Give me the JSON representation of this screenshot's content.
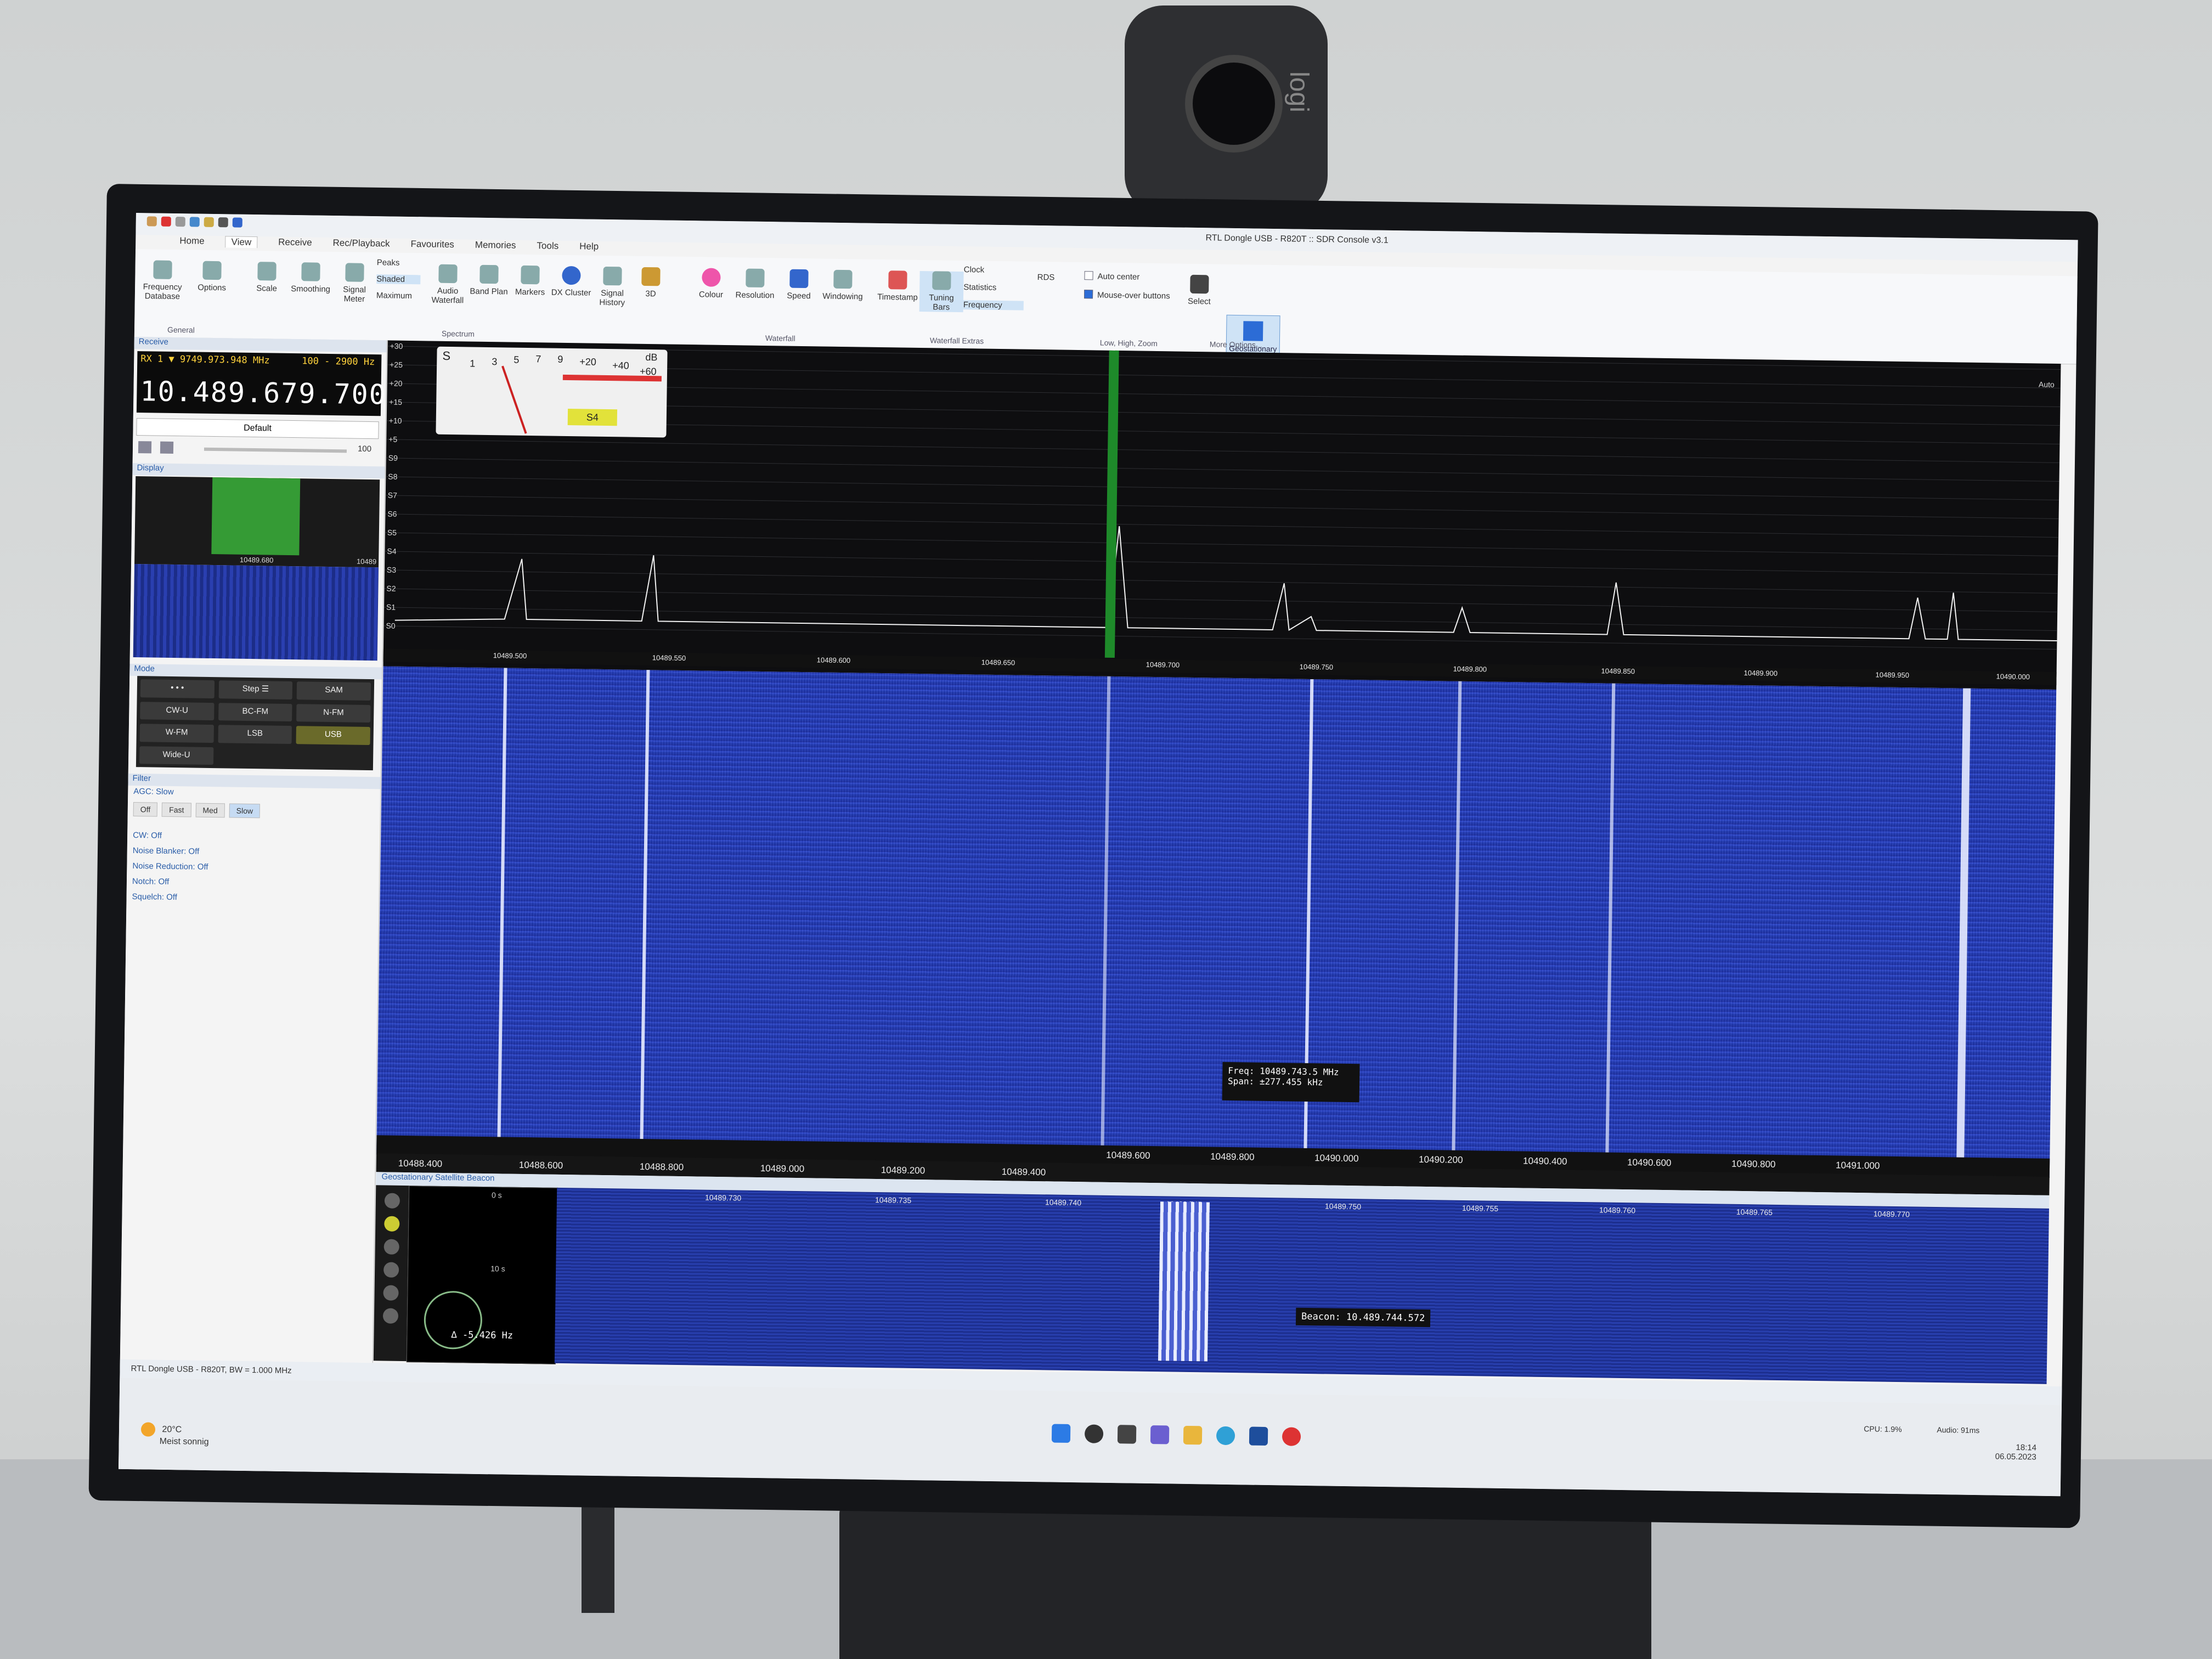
{
  "window": {
    "title": "RTL Dongle USB - R820T :: SDR Console v3.1"
  },
  "ribbon_tabs": [
    "Home",
    "View",
    "Receive",
    "Rec/Playback",
    "Favourites",
    "Memories",
    "Tools",
    "Help"
  ],
  "ribbon": {
    "general": {
      "label": "General",
      "buttons": [
        "Frequency Database",
        "Options"
      ]
    },
    "spectrum": {
      "label": "Spectrum",
      "buttons": [
        "Scale",
        "Smoothing",
        "Signal Meter",
        "Peaks",
        "Shaded",
        "Maximum",
        "Audio Waterfall",
        "Band Plan",
        "Markers",
        "DX Cluster",
        "Signal History",
        "3D"
      ]
    },
    "waterfall": {
      "label": "Waterfall",
      "buttons": [
        "Colour",
        "Resolution",
        "Speed",
        "Windowing"
      ]
    },
    "waterfall_extras": {
      "label": "Waterfall Extras",
      "buttons": [
        "Timestamp",
        "Tuning Bars",
        "Clock",
        "Statistics",
        "Frequency",
        "RDS"
      ]
    },
    "zoom": {
      "label": "Low, High, Zoom",
      "checks": [
        "Auto center",
        "Mouse-over buttons"
      ]
    },
    "more": {
      "label": "More Options...",
      "buttons": [
        "Select",
        "Geostationary Beacon"
      ]
    }
  },
  "left": {
    "receive_label": "Receive",
    "rx_line": "RX 1  ▼ 9749.973.948 MHz",
    "rx_bw": "100 - 2900 Hz",
    "rx_freq": "10.489.679.700",
    "preset": "Default",
    "volume": "100",
    "display_label": "Display",
    "mini_freq": "10489.680",
    "mini_freq_right": "10489",
    "mode_label": "Mode",
    "modes": [
      "• • •",
      "Step ☰",
      "SAM",
      "CW-U",
      "BC-FM",
      "N-FM",
      "W-FM",
      "LSB",
      "USB",
      "Wide-U"
    ],
    "filter_label": "Filter",
    "agc": "AGC: Slow",
    "agc_buttons": [
      "Off",
      "Fast",
      "Med",
      "Slow"
    ],
    "dsp": [
      "CW: Off",
      "Noise Blanker: Off",
      "Noise Reduction: Off",
      "Notch: Off",
      "Squelch: Off"
    ]
  },
  "spectrum": {
    "s_labels": [
      "+30",
      "+25",
      "+20",
      "+15",
      "+10",
      "+5",
      "S9",
      "S8",
      "S7",
      "S6",
      "S5",
      "S4",
      "S3",
      "S2",
      "S1",
      "S0"
    ],
    "meter_top": [
      "S",
      "1",
      "3",
      "5",
      "7",
      "9",
      "+20",
      "+40",
      "dB",
      "+60"
    ],
    "meter_badge": "S4",
    "auto": "Auto",
    "ticks": [
      "10489.500",
      "10489.550",
      "10489.600",
      "10489.650",
      "10489.700",
      "10489.750",
      "10489.800",
      "10489.850",
      "10489.900",
      "10489.950",
      "10490.000"
    ]
  },
  "waterfall": {
    "tooltip_freq": "Freq: 10489.743.5 MHz",
    "tooltip_span": "Span:   ±277.455 kHz",
    "ticks_top": [
      "10489.600",
      "10489.800",
      "10490.000",
      "10490.200",
      "10490.400",
      "10490.600",
      "10490.800",
      "10491.000"
    ],
    "ticks_bottom": [
      "10488.400",
      "10488.600",
      "10488.800",
      "10489.000",
      "10489.200",
      "10489.400"
    ]
  },
  "zoom": {
    "header": "Geostationary Satellite Beacon",
    "phase_value": "∆ -5.426 Hz",
    "phase_top": "0 s",
    "phase_mid": "10 s",
    "beacon": "Beacon: 10.489.744.572",
    "ticks": [
      "10489.730",
      "10489.735",
      "10489.740",
      "10489.745",
      "10489.750",
      "10489.755",
      "10489.760",
      "10489.765",
      "10489.770"
    ]
  },
  "status": "RTL Dongle USB - R820T, BW = 1.000 MHz",
  "taskbar": {
    "weather_temp": "20°C",
    "weather_desc": "Meist sonnig",
    "cpu": "CPU: 1.9%",
    "audio": "Audio: 91ms",
    "time": "18:14",
    "date": "06.05.2023"
  },
  "colors": {
    "accent": "#2c6cd6",
    "carrier": "#1e8a2a",
    "waterfall": "#2139b0",
    "meter_badge": "#e2e23a"
  }
}
